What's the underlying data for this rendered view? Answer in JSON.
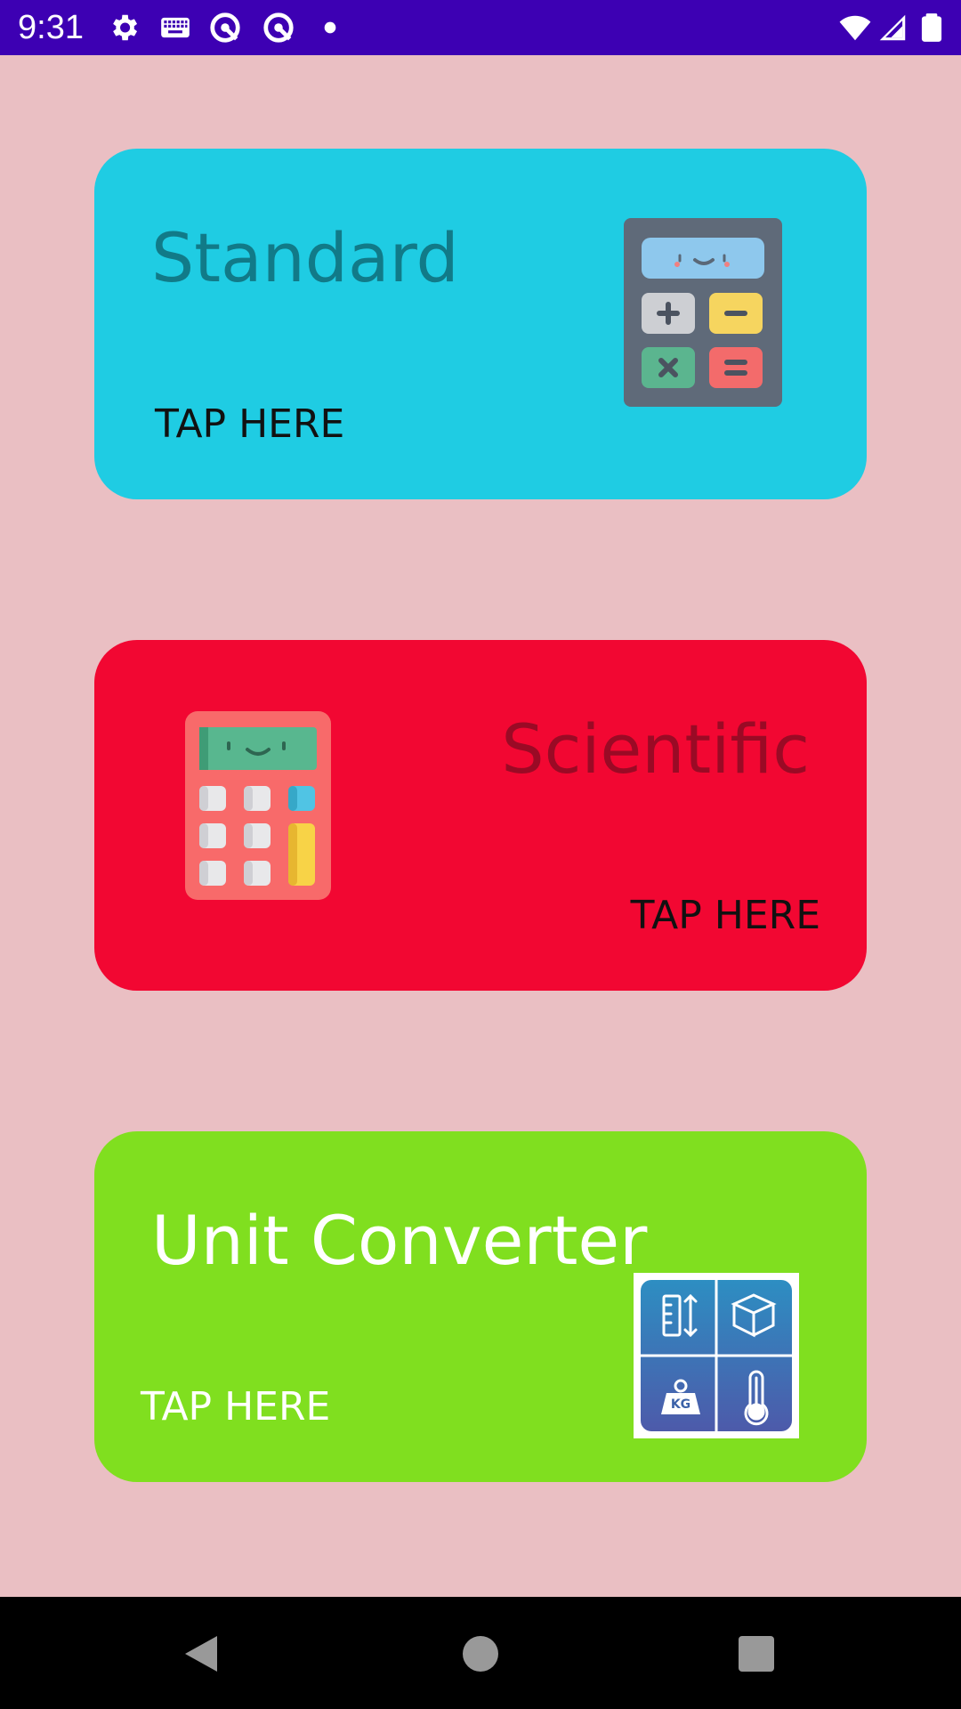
{
  "status_bar": {
    "time": "9:31",
    "icons": [
      "gear-icon",
      "keyboard-icon",
      "sync-icon",
      "sync-icon",
      "dot-icon",
      "wifi-icon",
      "signal-icon",
      "battery-icon"
    ]
  },
  "cards": [
    {
      "title": "Standard",
      "action": "TAP HERE",
      "background": "#1fcce3",
      "icon": "calculator-icon"
    },
    {
      "title": "Scientific",
      "action": "TAP HERE",
      "background": "#f20732",
      "icon": "scientific-calculator-icon"
    },
    {
      "title": "Unit Converter",
      "action": "TAP HERE",
      "background": "#80df1f",
      "icon": "unit-converter-icon"
    }
  ],
  "nav_bar": {
    "icons": [
      "back-icon",
      "home-icon",
      "recents-icon"
    ]
  },
  "colors": {
    "background": "#eabfc3",
    "status_bar": "#3d00b3",
    "nav_bar": "#000000"
  }
}
